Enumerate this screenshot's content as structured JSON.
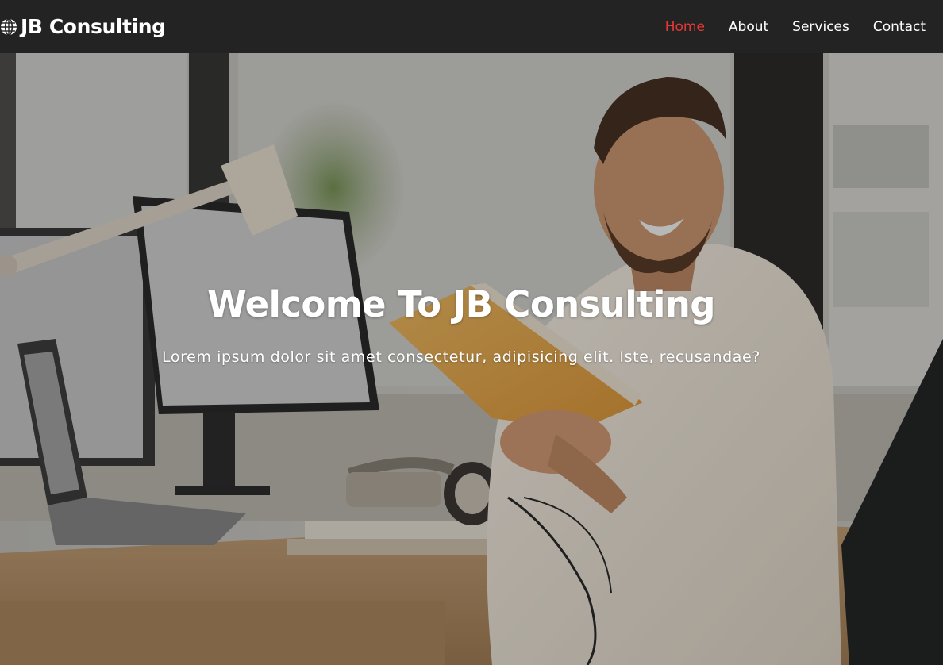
{
  "navbar": {
    "brand_icon": "globe-icon",
    "brand_name": "JB Consulting",
    "links": [
      {
        "label": "Home",
        "active": true
      },
      {
        "label": "About",
        "active": false
      },
      {
        "label": "Services",
        "active": false
      },
      {
        "label": "Contact",
        "active": false
      }
    ],
    "colors": {
      "background": "#232323",
      "text": "#ffffff",
      "active": "#e53935"
    }
  },
  "hero": {
    "title": "Welcome To JB Consulting",
    "subtitle": "Lorem ipsum dolor sit amet consectetur, adipisicing elit. Iste, recusandae?",
    "image": "photo of smiling bearded man in white shirt holding an open book at an office desk with monitors, lamp and headphones"
  }
}
